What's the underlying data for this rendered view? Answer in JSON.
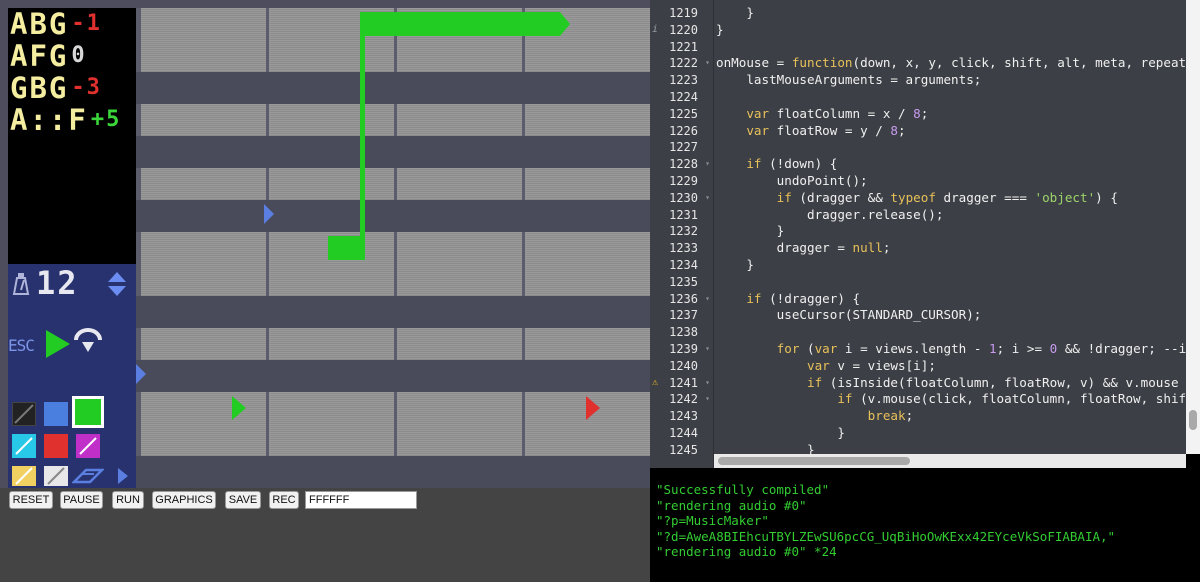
{
  "score_rows": [
    {
      "notes": "ABG",
      "delta": "-1",
      "delta_class": "neg"
    },
    {
      "notes": "AFG",
      "delta": "0",
      "delta_class": "zero"
    },
    {
      "notes": "GBG",
      "delta": "-3",
      "delta_class": "neg"
    },
    {
      "notes": "A::F",
      "delta": "+5",
      "delta_class": "pos"
    }
  ],
  "tempo": {
    "value": "12"
  },
  "esc_label": "ESC",
  "colors": {
    "accent_green": "#22cc22",
    "cursor_red": "#e0312e",
    "blue_marker": "#5b7fe0",
    "console_text": "#33cc33",
    "palette": [
      "#222222",
      "#4a7fe0",
      "#22cc22",
      "#28c8e8",
      "#e0312e",
      "#c030c8",
      "#f0d060",
      "#e8e8e8",
      "#5b7fe0"
    ]
  },
  "icons": {
    "timer": "timer-icon",
    "stepper": "up-down-stepper-icon",
    "play": "play-icon",
    "loop": "loop-play-icon",
    "pencil": "pencil-icon",
    "eraser": "eraser-icon"
  },
  "code": {
    "lines": [
      {
        "n": "1219",
        "t": "    }"
      },
      {
        "n": "1220",
        "t": "}",
        "marker": "i"
      },
      {
        "n": "1221",
        "t": ""
      },
      {
        "n": "1222",
        "t": "onMouse = function(down, x, y, click, shift, alt, meta, repeat) {",
        "fold": true
      },
      {
        "n": "1223",
        "t": "    lastMouseArguments = arguments;"
      },
      {
        "n": "1224",
        "t": ""
      },
      {
        "n": "1225",
        "t": "    var floatColumn = x / 8;"
      },
      {
        "n": "1226",
        "t": "    var floatRow = y / 8;"
      },
      {
        "n": "1227",
        "t": ""
      },
      {
        "n": "1228",
        "t": "    if (!down) {",
        "fold": true
      },
      {
        "n": "1229",
        "t": "        undoPoint();"
      },
      {
        "n": "1230",
        "t": "        if (dragger && typeof dragger === 'object') {",
        "fold": true
      },
      {
        "n": "1231",
        "t": "            dragger.release();"
      },
      {
        "n": "1232",
        "t": "        }"
      },
      {
        "n": "1233",
        "t": "        dragger = null;"
      },
      {
        "n": "1234",
        "t": "    }"
      },
      {
        "n": "1235",
        "t": ""
      },
      {
        "n": "1236",
        "t": "    if (!dragger) {",
        "fold": true
      },
      {
        "n": "1237",
        "t": "        useCursor(STANDARD_CURSOR);"
      },
      {
        "n": "1238",
        "t": ""
      },
      {
        "n": "1239",
        "t": "        for (var i = views.length - 1; i >= 0 && !dragger; --i) {",
        "fold": true
      },
      {
        "n": "1240",
        "t": "            var v = views[i];"
      },
      {
        "n": "1241",
        "t": "            if (isInside(floatColumn, floatRow, v) && v.mouse !=",
        "fold": true,
        "marker": "warn"
      },
      {
        "n": "1242",
        "t": "                if (v.mouse(click, floatColumn, floatRow, shift,",
        "fold": true
      },
      {
        "n": "1243",
        "t": "                    break;"
      },
      {
        "n": "1244",
        "t": "                }"
      },
      {
        "n": "1245",
        "t": "            }"
      }
    ]
  },
  "console": {
    "lines": [
      "\"Successfully compiled\"",
      "\"rendering audio #0\"",
      "\"?p=MusicMaker\"",
      "\"?d=AweA8BIEhcuTBYLZEwSU6pcCG_UqBiHoOwKExx42EYceVkSoFIABAIA,\"",
      "\"rendering audio #0\" *24"
    ]
  },
  "toolbar": {
    "reset": "RESET",
    "pause": "PAUSE",
    "run": "RUN",
    "graphics": "GRAPHICS",
    "save": "SAVE",
    "rec": "REC",
    "color_value": "FFFFFF"
  }
}
